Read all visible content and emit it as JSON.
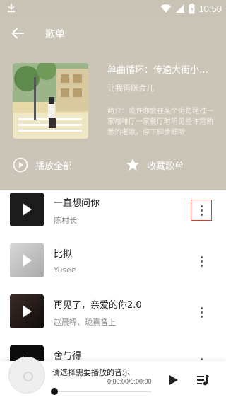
{
  "status_bar": {
    "time": "10:50",
    "icons": [
      "download-icon",
      "wifi-icon",
      "signal-icon",
      "battery-icon"
    ]
  },
  "header": {
    "title": "歌单",
    "back_icon": "arrow-left-icon"
  },
  "playlist": {
    "name": "单曲循环：传遍大街小巷的热歌",
    "creator": "让我再眯会儿",
    "description": "简介：或许你会在某个街角路过一家咖啡厅一家餐厅时听见些许常熟悉的老歌，停下脚步细听",
    "play_all_label": "播放全部",
    "favorite_label": "收藏歌单"
  },
  "songs": [
    {
      "title": "一直想问你",
      "artist": "陈村长"
    },
    {
      "title": "比拟",
      "artist": "Yusee"
    },
    {
      "title": "再见了，亲爱的你2.0",
      "artist": "赵晨唏、珑熹音上"
    },
    {
      "title": "舍与得",
      "artist": ""
    }
  ],
  "player": {
    "now_playing": "请选择需要播放的音乐",
    "time": "0:00:00/0:00:00",
    "progress": 0
  },
  "colors": {
    "header_bg": "#cbc5b8",
    "highlight": "#e03a2e"
  }
}
